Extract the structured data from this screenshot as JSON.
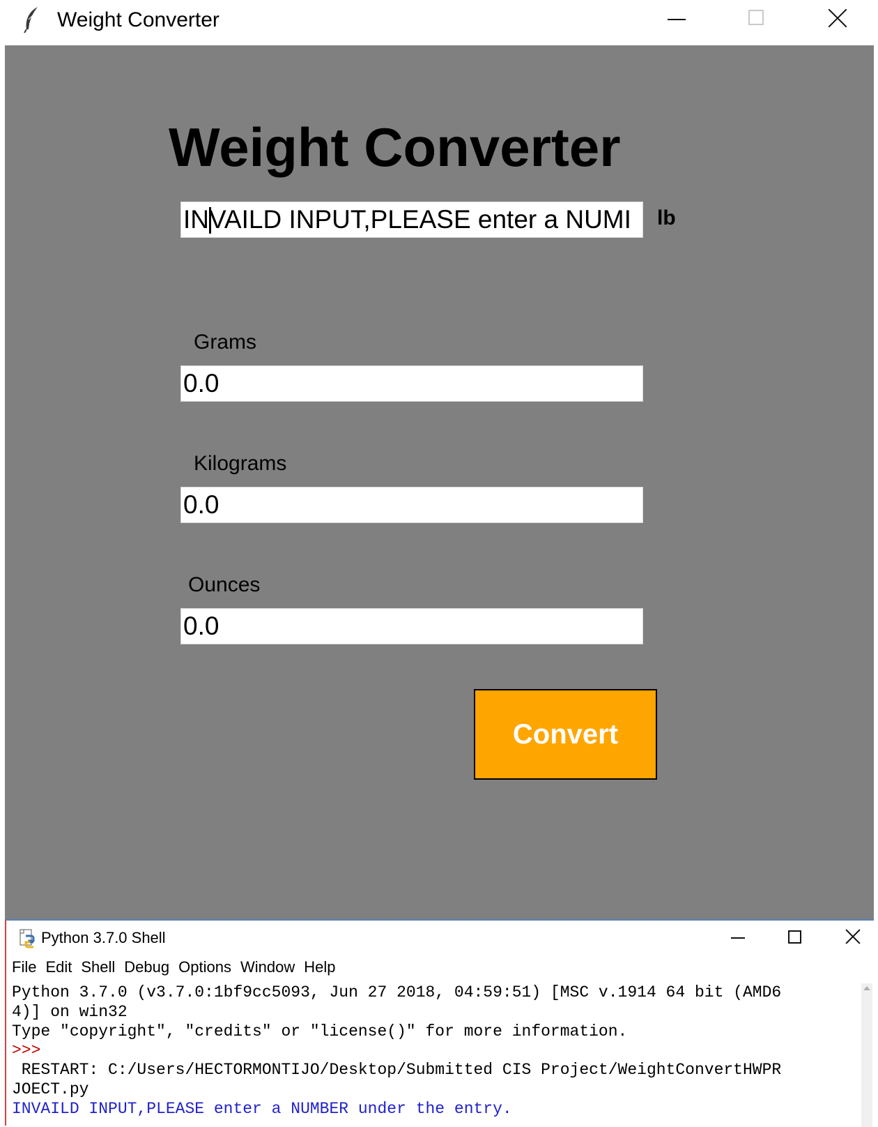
{
  "tk_window": {
    "title": "Weight Converter",
    "icon": "feather-icon",
    "heading": "Weight Converter",
    "pounds_entry_value": "INVAILD INPUT,PLEASE enter a NUMI",
    "unit_label": "lb",
    "fields": {
      "grams": {
        "label": "Grams",
        "value": "0.0"
      },
      "kilograms": {
        "label": "Kilograms",
        "value": "0.0"
      },
      "ounces": {
        "label": "Ounces",
        "value": "0.0"
      }
    },
    "convert_label": "Convert",
    "colors": {
      "background": "#808080",
      "button": "#ffa500",
      "button_text": "#ffffff"
    }
  },
  "shell_window": {
    "title": "Python 3.7.0 Shell",
    "icon": "python-shell-icon",
    "menu": [
      "File",
      "Edit",
      "Shell",
      "Debug",
      "Options",
      "Window",
      "Help"
    ],
    "lines": [
      "Python 3.7.0 (v3.7.0:1bf9cc5093, Jun 27 2018, 04:59:51) [MSC v.1914 64 bit (AMD6",
      "4)] on win32",
      "Type \"copyright\", \"credits\" or \"license()\" for more information.",
      ">>> ",
      " RESTART: C:/Users/HECTORMONTIJO/Desktop/Submitted CIS Project/WeightConvertHWPR",
      "JOECT.py",
      "INVAILD INPUT,PLEASE enter a NUMBER under the entry."
    ],
    "colors": {
      "output": "#000000",
      "prompt": "#c00000",
      "stdout": "#2222cc"
    }
  }
}
